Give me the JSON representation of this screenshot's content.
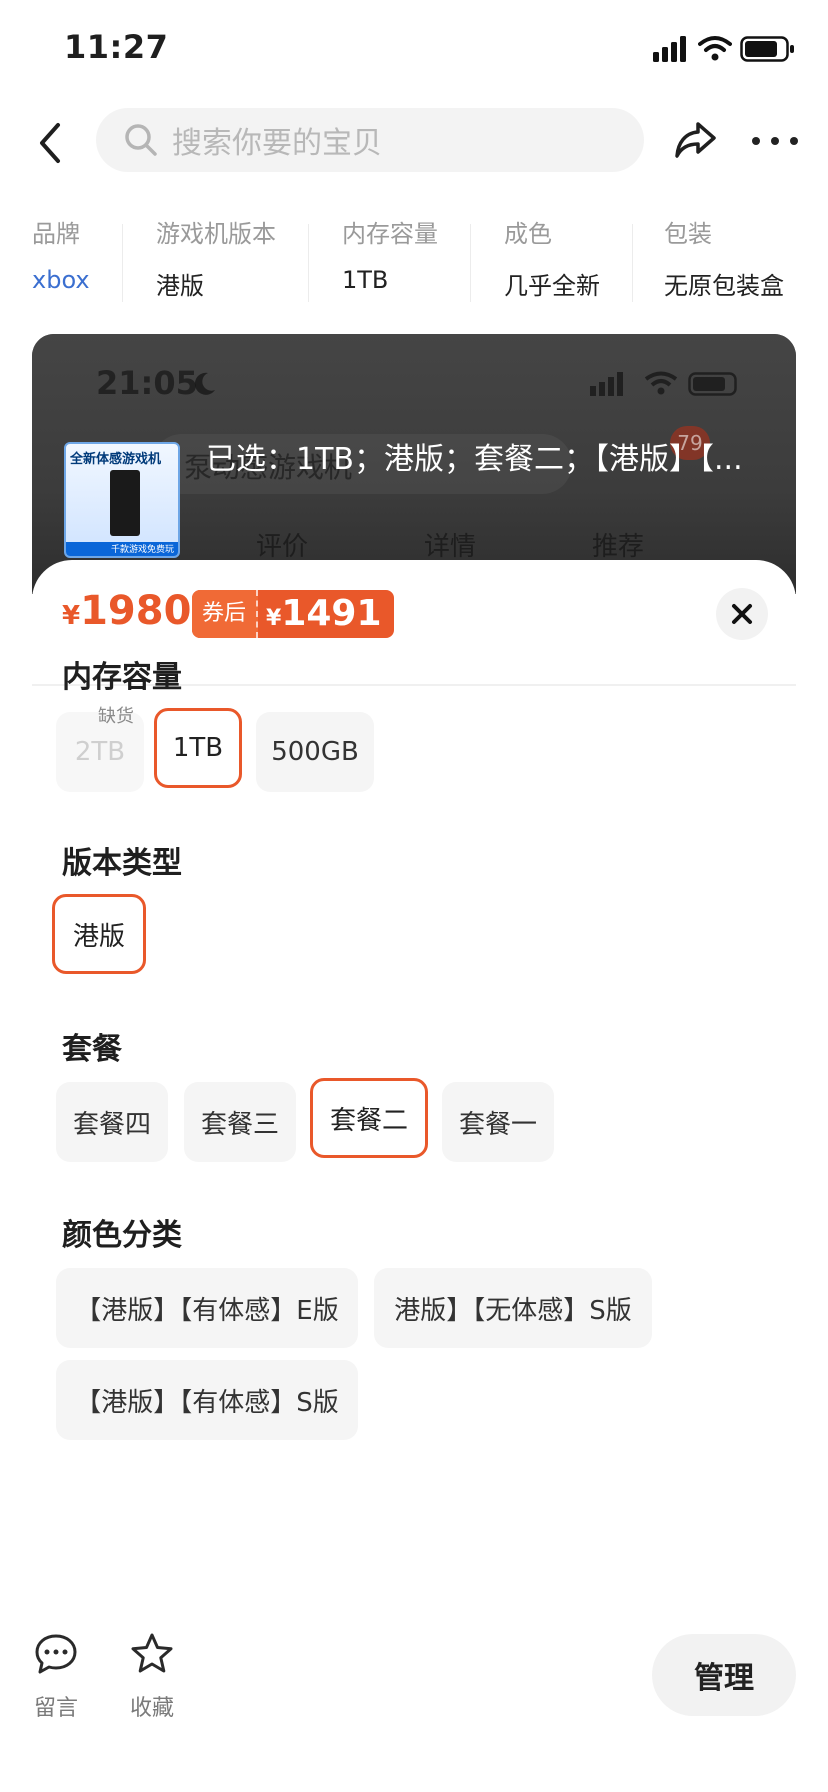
{
  "status_bar": {
    "time": "11:27"
  },
  "search": {
    "placeholder": "搜索你要的宝贝"
  },
  "attributes": [
    {
      "label": "品牌",
      "value": "xbox"
    },
    {
      "label": "游戏机版本",
      "value": "港版"
    },
    {
      "label": "内存容量",
      "value": "1TB"
    },
    {
      "label": "成色",
      "value": "几乎全新"
    },
    {
      "label": "包装",
      "value": "无原包装盒"
    }
  ],
  "preview": {
    "time": "21:05",
    "search_text": "泵动感游戏机",
    "cart_count": "79",
    "tabs": [
      "评价",
      "详情",
      "推荐"
    ],
    "thumb_title": "全新体感游戏机",
    "thumb_footer": "千款游戏免费玩",
    "selected_summary": "已选：1TB；港版；套餐二；【港版】【..."
  },
  "price": {
    "currency": "¥",
    "original": "1980",
    "coupon_label": "券后",
    "after_coupon": "1491"
  },
  "sections": {
    "storage": {
      "title": "内存容量",
      "options": [
        {
          "label": "2TB",
          "tag": "缺货",
          "state": "disabled"
        },
        {
          "label": "1TB",
          "state": "selected"
        },
        {
          "label": "500GB",
          "state": "normal"
        }
      ]
    },
    "version": {
      "title": "版本类型",
      "options": [
        {
          "label": "港版",
          "state": "selected"
        }
      ]
    },
    "package": {
      "title": "套餐",
      "options": [
        {
          "label": "套餐四",
          "state": "normal"
        },
        {
          "label": "套餐三",
          "state": "normal"
        },
        {
          "label": "套餐二",
          "state": "selected"
        },
        {
          "label": "套餐一",
          "state": "normal"
        }
      ]
    },
    "color": {
      "title": "颜色分类",
      "options": [
        {
          "label": "【港版】【有体感】E版",
          "state": "normal"
        },
        {
          "label": "港版】【无体感】S版",
          "state": "normal"
        },
        {
          "label": "【港版】【有体感】S版",
          "state": "normal"
        }
      ]
    }
  },
  "bottom_bar": {
    "message_label": "留言",
    "favorite_label": "收藏",
    "manage_label": "管理"
  },
  "colors": {
    "accent": "#e9582a",
    "brand_link": "#3b6fd0"
  },
  "icons": [
    "signal-icon",
    "wifi-icon",
    "battery-icon",
    "back-arrow-icon",
    "search-icon",
    "share-icon",
    "more-icon",
    "close-icon",
    "message-icon",
    "star-icon"
  ]
}
